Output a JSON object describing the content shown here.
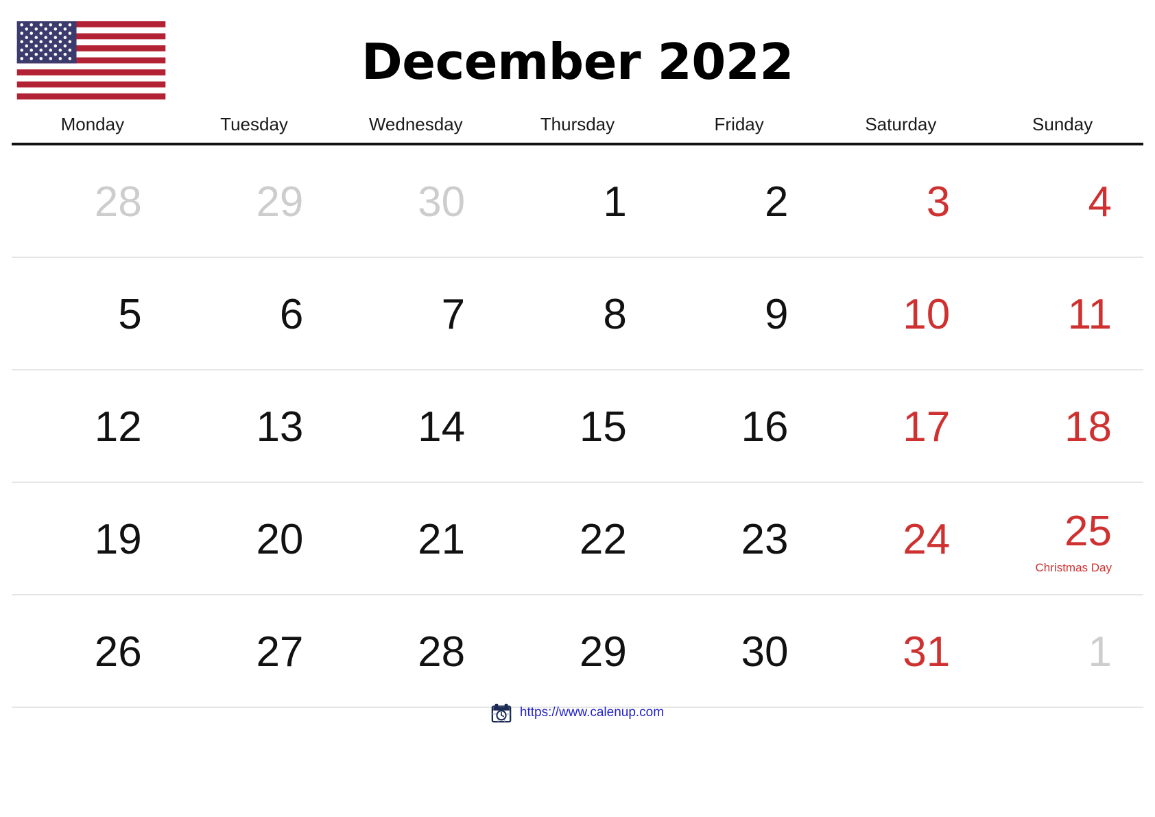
{
  "flag": {
    "name": "united-states-flag",
    "colors": {
      "red": "#B22234",
      "white": "#FFFFFF",
      "blue": "#3C3B6E"
    },
    "alt": "United States flag"
  },
  "header": {
    "title": "December 2022",
    "month": "December",
    "year": "2022"
  },
  "calendar": {
    "weekday_headers": [
      "Monday",
      "Tuesday",
      "Wednesday",
      "Thursday",
      "Friday",
      "Saturday",
      "Sunday"
    ],
    "colors": {
      "weekend_background": "#FDF8EC",
      "weekend_text": "#CF3030",
      "other_month_text": "#CDCDCD",
      "day_text": "#111111",
      "header_rule": "#111111",
      "row_rule": "#E6E6E6"
    },
    "weeks": [
      {
        "days": [
          {
            "num": "28",
            "month": "prev",
            "weekend": false,
            "holiday": ""
          },
          {
            "num": "29",
            "month": "prev",
            "weekend": false,
            "holiday": ""
          },
          {
            "num": "30",
            "month": "prev",
            "weekend": false,
            "holiday": ""
          },
          {
            "num": "1",
            "month": "current",
            "weekend": false,
            "holiday": ""
          },
          {
            "num": "2",
            "month": "current",
            "weekend": false,
            "holiday": ""
          },
          {
            "num": "3",
            "month": "current",
            "weekend": true,
            "holiday": ""
          },
          {
            "num": "4",
            "month": "current",
            "weekend": true,
            "holiday": ""
          }
        ]
      },
      {
        "days": [
          {
            "num": "5",
            "month": "current",
            "weekend": false,
            "holiday": ""
          },
          {
            "num": "6",
            "month": "current",
            "weekend": false,
            "holiday": ""
          },
          {
            "num": "7",
            "month": "current",
            "weekend": false,
            "holiday": ""
          },
          {
            "num": "8",
            "month": "current",
            "weekend": false,
            "holiday": ""
          },
          {
            "num": "9",
            "month": "current",
            "weekend": false,
            "holiday": ""
          },
          {
            "num": "10",
            "month": "current",
            "weekend": true,
            "holiday": ""
          },
          {
            "num": "11",
            "month": "current",
            "weekend": true,
            "holiday": ""
          }
        ]
      },
      {
        "days": [
          {
            "num": "12",
            "month": "current",
            "weekend": false,
            "holiday": ""
          },
          {
            "num": "13",
            "month": "current",
            "weekend": false,
            "holiday": ""
          },
          {
            "num": "14",
            "month": "current",
            "weekend": false,
            "holiday": ""
          },
          {
            "num": "15",
            "month": "current",
            "weekend": false,
            "holiday": ""
          },
          {
            "num": "16",
            "month": "current",
            "weekend": false,
            "holiday": ""
          },
          {
            "num": "17",
            "month": "current",
            "weekend": true,
            "holiday": ""
          },
          {
            "num": "18",
            "month": "current",
            "weekend": true,
            "holiday": ""
          }
        ]
      },
      {
        "days": [
          {
            "num": "19",
            "month": "current",
            "weekend": false,
            "holiday": ""
          },
          {
            "num": "20",
            "month": "current",
            "weekend": false,
            "holiday": ""
          },
          {
            "num": "21",
            "month": "current",
            "weekend": false,
            "holiday": ""
          },
          {
            "num": "22",
            "month": "current",
            "weekend": false,
            "holiday": ""
          },
          {
            "num": "23",
            "month": "current",
            "weekend": false,
            "holiday": ""
          },
          {
            "num": "24",
            "month": "current",
            "weekend": true,
            "holiday": ""
          },
          {
            "num": "25",
            "month": "current",
            "weekend": true,
            "holiday": "Christmas Day"
          }
        ]
      },
      {
        "days": [
          {
            "num": "26",
            "month": "current",
            "weekend": false,
            "holiday": ""
          },
          {
            "num": "27",
            "month": "current",
            "weekend": false,
            "holiday": ""
          },
          {
            "num": "28",
            "month": "current",
            "weekend": false,
            "holiday": ""
          },
          {
            "num": "29",
            "month": "current",
            "weekend": false,
            "holiday": ""
          },
          {
            "num": "30",
            "month": "current",
            "weekend": false,
            "holiday": ""
          },
          {
            "num": "31",
            "month": "current",
            "weekend": true,
            "holiday": ""
          },
          {
            "num": "1",
            "month": "next",
            "weekend": false,
            "holiday": ""
          }
        ]
      }
    ]
  },
  "footer": {
    "icon_name": "calendar-clock-icon",
    "url": "https://www.calenup.com",
    "url_color": "#2222CC"
  }
}
